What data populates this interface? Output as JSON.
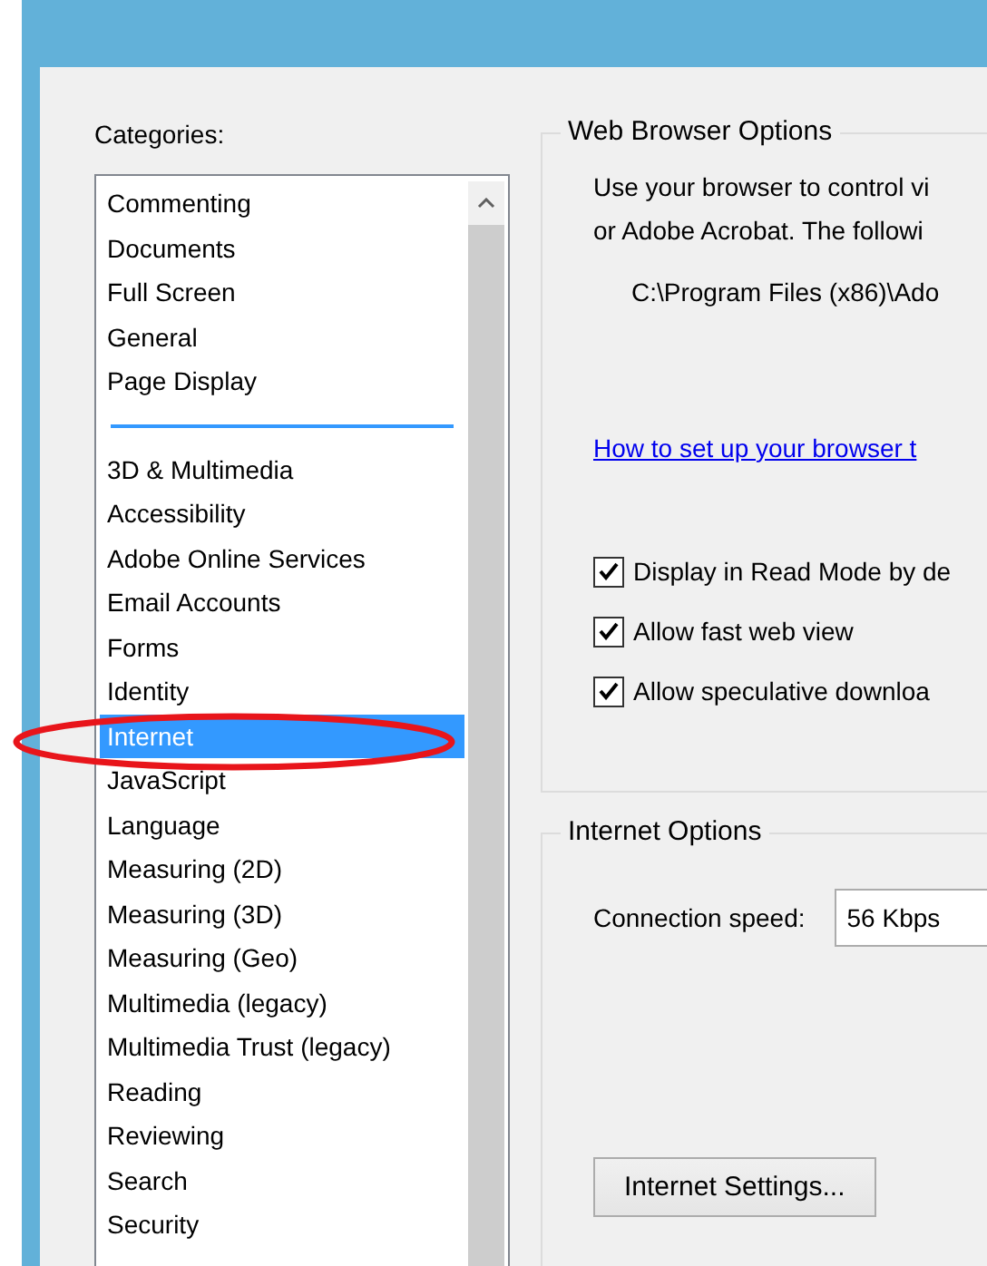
{
  "categories": {
    "label": "Categories:",
    "groups": [
      {
        "items": [
          {
            "label": "Commenting",
            "selected": false
          },
          {
            "label": "Documents",
            "selected": false
          },
          {
            "label": "Full Screen",
            "selected": false
          },
          {
            "label": "General",
            "selected": false
          },
          {
            "label": "Page Display",
            "selected": false
          }
        ]
      },
      {
        "items": [
          {
            "label": "3D & Multimedia",
            "selected": false
          },
          {
            "label": "Accessibility",
            "selected": false
          },
          {
            "label": "Adobe Online Services",
            "selected": false
          },
          {
            "label": "Email Accounts",
            "selected": false
          },
          {
            "label": "Forms",
            "selected": false
          },
          {
            "label": "Identity",
            "selected": false
          },
          {
            "label": "Internet",
            "selected": true
          },
          {
            "label": "JavaScript",
            "selected": false
          },
          {
            "label": "Language",
            "selected": false
          },
          {
            "label": "Measuring (2D)",
            "selected": false
          },
          {
            "label": "Measuring (3D)",
            "selected": false
          },
          {
            "label": "Measuring (Geo)",
            "selected": false
          },
          {
            "label": "Multimedia (legacy)",
            "selected": false
          },
          {
            "label": "Multimedia Trust (legacy)",
            "selected": false
          },
          {
            "label": "Reading",
            "selected": false
          },
          {
            "label": "Reviewing",
            "selected": false
          },
          {
            "label": "Search",
            "selected": false
          },
          {
            "label": "Security",
            "selected": false
          }
        ]
      }
    ]
  },
  "web_browser_options": {
    "title": "Web Browser Options",
    "description": [
      "Use your browser to control vi",
      "or Adobe Acrobat. The followi"
    ],
    "path": "C:\\Program Files (x86)\\Ado",
    "link": "How to set up your browser t",
    "checkboxes": [
      {
        "label": "Display in Read Mode by de",
        "checked": true
      },
      {
        "label": "Allow fast web view",
        "checked": true
      },
      {
        "label": "Allow speculative downloa",
        "checked": true
      }
    ]
  },
  "internet_options": {
    "title": "Internet Options",
    "connection_speed": {
      "label": "Connection speed:",
      "value": "56 Kbps"
    },
    "button": "Internet Settings..."
  },
  "annotation": {
    "kind": "ellipse"
  }
}
